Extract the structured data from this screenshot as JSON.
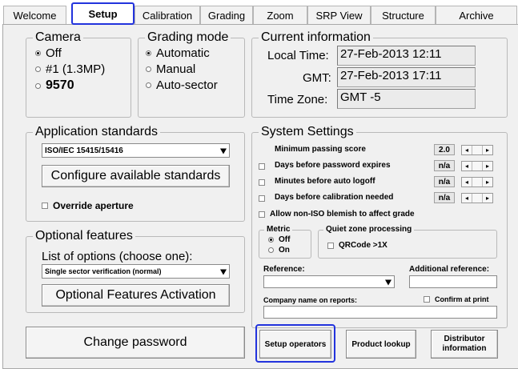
{
  "tabs": [
    {
      "label": "Welcome"
    },
    {
      "label": "Setup"
    },
    {
      "label": "Calibration"
    },
    {
      "label": "Grading"
    },
    {
      "label": "Zoom"
    },
    {
      "label": "SRP View"
    },
    {
      "label": "Structure"
    },
    {
      "label": "Archive"
    }
  ],
  "camera": {
    "title": "Camera",
    "options": [
      "Off",
      "#1 (1.3MP)",
      "9570"
    ],
    "selected": "Off"
  },
  "grading_mode": {
    "title": "Grading mode",
    "options": [
      "Automatic",
      "Manual",
      "Auto-sector"
    ],
    "selected": "Automatic"
  },
  "current_info": {
    "title": "Current information",
    "local_time_label": "Local Time:",
    "local_time": "27-Feb-2013 12:11",
    "gmt_label": "GMT:",
    "gmt": "27-Feb-2013 17:11",
    "timezone_label": "Time Zone:",
    "timezone": "GMT -5"
  },
  "app_standards": {
    "title": "Application standards",
    "selected": "ISO/IEC 15415/15416",
    "configure_label": "Configure available standards",
    "override_label": "Override aperture"
  },
  "optional_features": {
    "title": "Optional features",
    "list_label": "List of options (choose one):",
    "selected": "Single sector verification (normal)",
    "activation_label": "Optional Features Activation"
  },
  "change_password_label": "Change password",
  "system_settings": {
    "title": "System Settings",
    "rows": [
      {
        "label": "Minimum passing score",
        "value": "2.0",
        "has_checkbox": false
      },
      {
        "label": "Days before password expires",
        "value": "n/a",
        "has_checkbox": true
      },
      {
        "label": "Minutes before auto logoff",
        "value": "n/a",
        "has_checkbox": true
      },
      {
        "label": "Days before calibration needed",
        "value": "n/a",
        "has_checkbox": true
      }
    ],
    "allow_label": "Allow non-ISO blemish to affect grade",
    "metric": {
      "title": "Metric",
      "options": [
        "Off",
        "On"
      ],
      "selected": "Off"
    },
    "quiet_zone": {
      "title": "Quiet zone processing",
      "qrcode_label": "QRCode >1X"
    },
    "reference_label": "Reference:",
    "additional_reference_label": "Additional reference:",
    "company_label": "Company name on reports:",
    "confirm_label": "Confirm at print"
  },
  "buttons": {
    "setup_operators": "Setup operators",
    "product_lookup": "Product lookup",
    "distributor_info": "Distributor information"
  },
  "colors": {
    "highlight": "#2233dd",
    "panel": "#f0f0f0"
  }
}
